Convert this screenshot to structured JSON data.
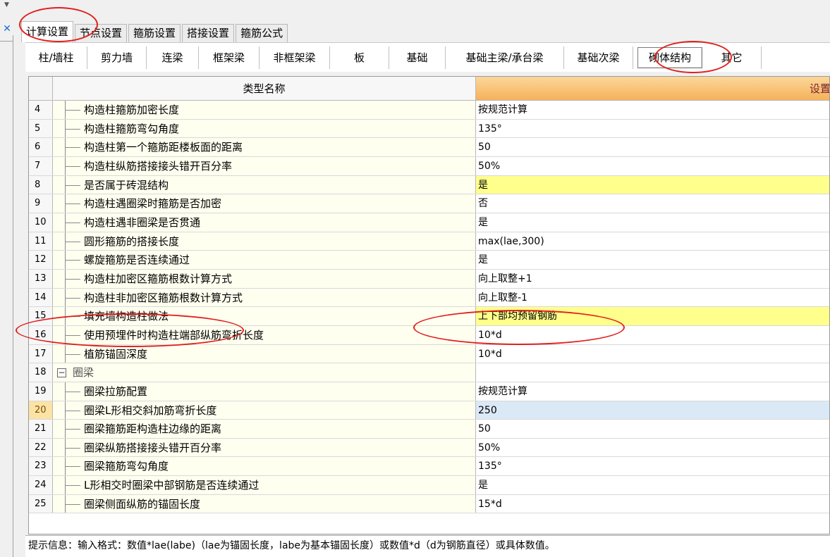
{
  "top_tabs": [
    "计算设置",
    "节点设置",
    "箍筋设置",
    "搭接设置",
    "箍筋公式"
  ],
  "sub_tabs": [
    "柱/墙柱",
    "剪力墙",
    "连梁",
    "框架梁",
    "非框架梁",
    "板",
    "基础",
    "基础主梁/承台梁",
    "基础次梁",
    "砌体结构",
    "其它"
  ],
  "header": {
    "name": "类型名称",
    "setting": "设置"
  },
  "rows": [
    {
      "num": "4",
      "name": "构造柱箍筋加密长度",
      "value": "按规范计算"
    },
    {
      "num": "5",
      "name": "构造柱箍筋弯勾角度",
      "value": "135°"
    },
    {
      "num": "6",
      "name": "构造柱第一个箍筋距楼板面的距离",
      "value": "50"
    },
    {
      "num": "7",
      "name": "构造柱纵筋搭接接头错开百分率",
      "value": "50%"
    },
    {
      "num": "8",
      "name": "是否属于砖混结构",
      "value": "是"
    },
    {
      "num": "9",
      "name": "构造柱遇圈梁时箍筋是否加密",
      "value": "否"
    },
    {
      "num": "10",
      "name": "构造柱遇非圈梁是否贯通",
      "value": "是"
    },
    {
      "num": "11",
      "name": "圆形箍筋的搭接长度",
      "value": "max(lae,300)"
    },
    {
      "num": "12",
      "name": "螺旋箍筋是否连续通过",
      "value": "是"
    },
    {
      "num": "13",
      "name": "构造柱加密区箍筋根数计算方式",
      "value": "向上取整+1"
    },
    {
      "num": "14",
      "name": "构造柱非加密区箍筋根数计算方式",
      "value": "向上取整-1"
    },
    {
      "num": "15",
      "name": "填充墙构造柱做法",
      "value": "上下部均预留钢筋"
    },
    {
      "num": "16",
      "name": "使用预埋件时构造柱端部纵筋弯折长度",
      "value": "10*d"
    },
    {
      "num": "17",
      "name": "植筋锚固深度",
      "value": "10*d"
    },
    {
      "num": "18",
      "name": "圈梁",
      "value": ""
    },
    {
      "num": "19",
      "name": "圈梁拉筋配置",
      "value": "按规范计算"
    },
    {
      "num": "20",
      "name": "圈梁L形相交斜加筋弯折长度",
      "value": "250"
    },
    {
      "num": "21",
      "name": "圈梁箍筋距构造柱边缘的距离",
      "value": "50"
    },
    {
      "num": "22",
      "name": "圈梁纵筋搭接接头错开百分率",
      "value": "50%"
    },
    {
      "num": "23",
      "name": "圈梁箍筋弯勾角度",
      "value": "135°"
    },
    {
      "num": "24",
      "name": "L形相交时圈梁中部钢筋是否连续通过",
      "value": "是"
    },
    {
      "num": "25",
      "name": "圈梁侧面纵筋的锚固长度",
      "value": "15*d"
    }
  ],
  "status": "提示信息：输入格式：数值*lae(labe)（lae为锚固长度，labe为基本锚固长度）或数值*d（d为钢筋直径）或具体数值。",
  "icons": {
    "close": "close-icon",
    "dropdown": "chevron-down-icon",
    "collapse": "minus-icon"
  },
  "colors": {
    "highlight_yellow": "#ffff8c",
    "selected_blue": "#dbe9f6",
    "header_orange": "#f5b25a",
    "annotation_red": "#e0201e"
  }
}
